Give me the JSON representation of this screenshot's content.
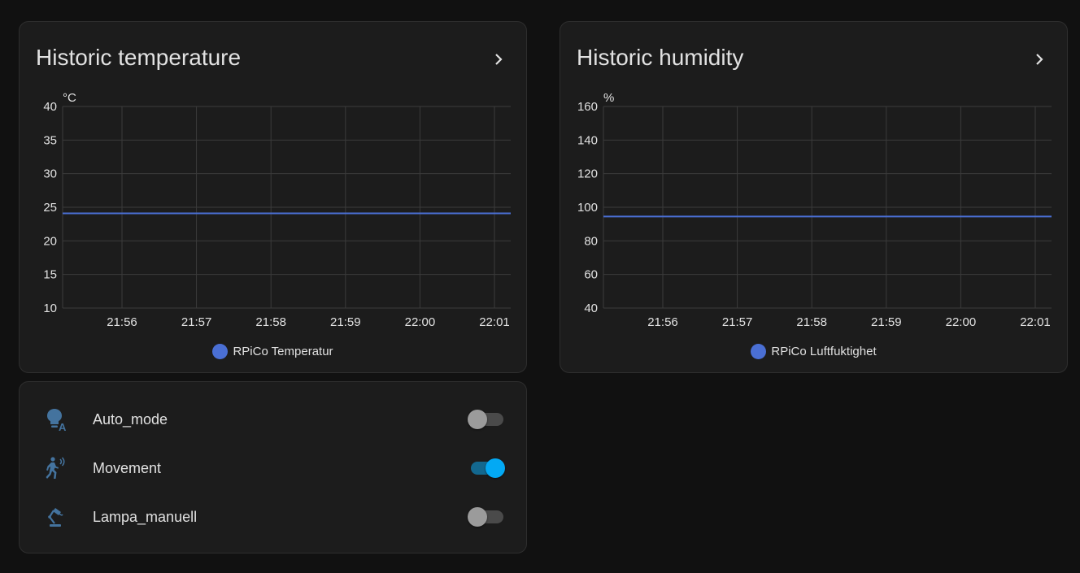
{
  "colors": {
    "series": "#4a6fd4",
    "icon": "#44739e",
    "toggle_on": "#03a9f4"
  },
  "temperature_card": {
    "title": "Historic temperature",
    "chart_data": {
      "type": "line",
      "ylabel": "°C",
      "ylim": [
        10,
        40
      ],
      "yticks": [
        40,
        35,
        30,
        25,
        20,
        15,
        10
      ],
      "xticks": [
        "21:56",
        "21:57",
        "21:58",
        "21:59",
        "22:00",
        "22:01"
      ],
      "series": [
        {
          "name": "RPiCo Temperatur",
          "values": [
            24.1,
            24.1,
            24.1,
            24.1,
            24.1,
            24.1,
            24.1
          ]
        }
      ],
      "grid": true,
      "legend": "bottom-center"
    }
  },
  "humidity_card": {
    "title": "Historic humidity",
    "chart_data": {
      "type": "line",
      "ylabel": "%",
      "ylim": [
        40,
        160
      ],
      "yticks": [
        160,
        140,
        120,
        100,
        80,
        60,
        40
      ],
      "xticks": [
        "21:56",
        "21:57",
        "21:58",
        "21:59",
        "22:00",
        "22:01"
      ],
      "series": [
        {
          "name": "RPiCo Luftfuktighet",
          "values": [
            94.5,
            94.5,
            94.5,
            94.5,
            94.5,
            94.5,
            94.5
          ]
        }
      ],
      "grid": true,
      "legend": "bottom-center"
    }
  },
  "switches": [
    {
      "label": "Auto_mode",
      "icon": "lightbulb-auto-icon",
      "on": false
    },
    {
      "label": "Movement",
      "icon": "motion-sensor-icon",
      "on": true
    },
    {
      "label": "Lampa_manuell",
      "icon": "desk-lamp-icon",
      "on": false
    }
  ]
}
